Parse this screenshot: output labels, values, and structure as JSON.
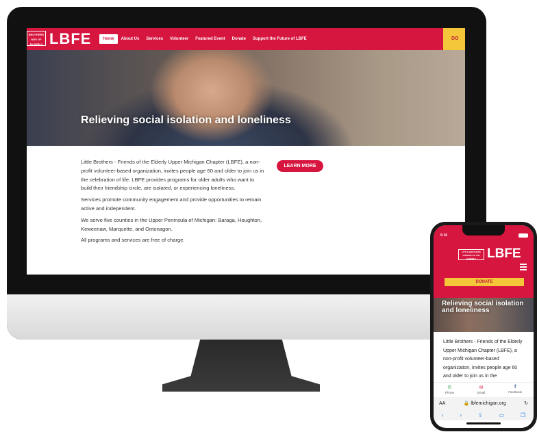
{
  "desktop": {
    "logo_box_text": "BROTHERS NDS OF ELDERLY",
    "logo_text": "LBFE",
    "menu": [
      "Home",
      "About Us",
      "Services",
      "Volunteer",
      "Featured Event",
      "Donate",
      "Support the Future of LBFE"
    ],
    "donate": "DO",
    "hero_title": "Relieving social isolation and loneliness",
    "learn_more": "LEARN MORE",
    "paragraphs": [
      "Little Brothers - Friends of the Elderly Upper Michigan Chapter (LBFE), a non-profit volunteer-based organization, invites people age 60 and older to join us in the celebration of life. LBFE provides programs for older adults who want to build their friendship circle, are isolated, or experiencing loneliness.",
      "Services promote community engagement and provide opportunities to remain active and independent.",
      "We serve five counties in the Upper Peninsula of Michigan: Baraga, Houghton, Keweenaw, Marquette, and Ontonagon.",
      "All programs and services are free of charge."
    ]
  },
  "phone": {
    "time": "5:16",
    "logo_box_text": "LITTLE BROTHERS FRIENDS OF THE ELDERLY",
    "logo_text": "LBFE",
    "donate": "DONATE",
    "hero_title": "Relieving social isolation and loneliness",
    "copy": "Little Brothers - Friends of the Elderly Upper Michigan Chapter (LBFE), a non-profit volunteer-based organization, invites people age 60 and older to join us in the",
    "contact": [
      "Phone",
      "Email",
      "Facebook"
    ],
    "address_aa": "AA",
    "address": "lbfemichigan.org"
  },
  "colors": {
    "brand_red": "#d6163f",
    "donate_yellow": "#f4c63a"
  }
}
